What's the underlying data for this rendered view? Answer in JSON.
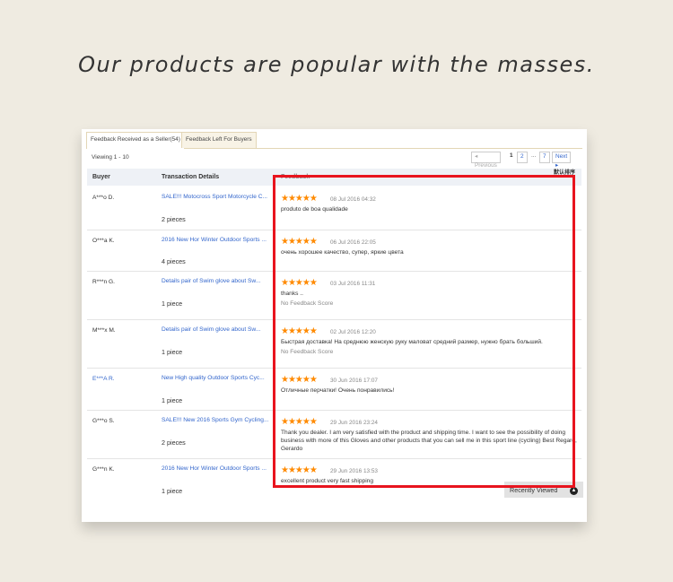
{
  "headline": "Our products are popular with the masses.",
  "tabs": [
    {
      "label": "Feedback Received as a Seller(54)"
    },
    {
      "label": "Feedback Left For Buyers"
    }
  ],
  "viewing": "Viewing 1 - 10",
  "pagination": {
    "prev": "◂ Previous",
    "pages": [
      "1",
      "2",
      "...",
      "7"
    ],
    "next": "Next ▸",
    "current": "1"
  },
  "table": {
    "headers": {
      "buyer": "Buyer",
      "transaction": "Transaction Details",
      "feedback": "Feedback",
      "sort": "默认排序"
    },
    "rows": [
      {
        "buyer": "A***o D.",
        "title": "SALE!!! Motocross Sport Motorcycle C...",
        "qty": "2 pieces",
        "stars": "★★★★★",
        "date": "08 Jul 2016 04:32",
        "comment": "produto de boa qualidade",
        "note": ""
      },
      {
        "buyer": "O***a K.",
        "title": "2016 New Hor Winter Outdoor Sports ...",
        "qty": "4 pieces",
        "stars": "★★★★★",
        "date": "06 Jul 2016 22:05",
        "comment": "очень хорошее качество, супер, яркие цвета",
        "note": ""
      },
      {
        "buyer": "R***n G.",
        "title": "Details pair of Swim glove about Sw...",
        "qty": "1 piece",
        "stars": "★★★★★",
        "date": "03 Jul 2016 11:31",
        "comment": "thanks ..",
        "note": "No Feedback Score"
      },
      {
        "buyer": "M***x M.",
        "title": "Details pair of Swim glove about Sw...",
        "qty": "1 piece",
        "stars": "★★★★★",
        "date": "02 Jul 2016 12:20",
        "comment": "Быстрая доставка! На среднюю женскую руку маловат средний размер, нужно брать больший.",
        "note": "No Feedback Score"
      },
      {
        "buyer": "E***A R.",
        "title": "New High quality Outdoor Sports Cyc...",
        "qty": "1 piece",
        "stars": "★★★★★",
        "date": "30 Jun 2016 17:07",
        "comment": "Отличные перчатки! Очень понравились!",
        "note": ""
      },
      {
        "buyer": "G***o S.",
        "title": "SALE!!! New 2016 Sports Gym Cycling...",
        "qty": "2 pieces",
        "stars": "★★★★★",
        "date": "29 Jun 2016 23:24",
        "comment": "Thank you dealer. I am very satisfied with the product and shipping time. I want to see the possibility of doing business with more of this Gloves and other products that you can sell me in this sport line (cycling) Best Regard, Gerardo",
        "note": ""
      },
      {
        "buyer": "G***n K.",
        "title": "2016 New Hor Winter Outdoor Sports ...",
        "qty": "1 piece",
        "stars": "★★★★★",
        "date": "29 Jun 2016 13:53",
        "comment": "excellent product very fast shipping",
        "note": ""
      }
    ]
  },
  "recently_viewed": "Recently Viewed",
  "colors": {
    "highlight_box": "#e8141e",
    "stars": "#ff8a00",
    "link": "#3366cc",
    "background": "#efebe1"
  }
}
